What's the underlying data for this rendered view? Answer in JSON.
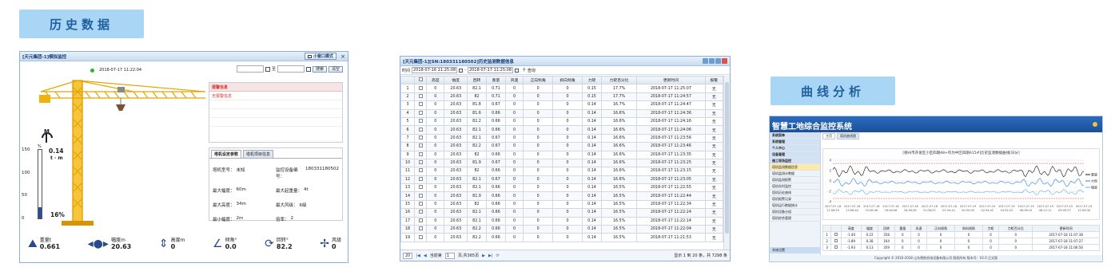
{
  "headings": {
    "history": "历史数据",
    "curve": "曲线分析"
  },
  "monitor": {
    "title": "[天元集团-1]模拟监控",
    "timestamp": "2018-07-17 11:22:04",
    "small_window_label": "小窗口模式",
    "date_sep": "至",
    "search_label": "搜索",
    "clear_label": "清空",
    "alarm_header": "报警信息",
    "no_alarm_text": "无报警信息",
    "tabs": [
      "塔机设定参数",
      "塔机项目信息"
    ],
    "params": [
      {
        "k": "塔机型号：",
        "v": "未知"
      },
      {
        "k": "监控设备编号：",
        "v": "180331180502"
      },
      {
        "k": "最大幅度：",
        "v": "60m"
      },
      {
        "k": "最大起重量：",
        "v": "4t"
      },
      {
        "k": "最大高度：",
        "v": "34m"
      },
      {
        "k": "最大风级：",
        "v": "6级"
      },
      {
        "k": "最小幅度：",
        "v": "2m"
      },
      {
        "k": "倍率：",
        "v": "2"
      }
    ],
    "moment": {
      "label": "M",
      "value": "0.14",
      "unit": "t · m",
      "percent_unit": "%",
      "percent": "16%",
      "percent_fraction": 0.16
    },
    "gauge_ticks": [
      "150",
      "100",
      "50",
      "0"
    ],
    "metrics": [
      {
        "label": "重量t",
        "value": "0.661",
        "icon": "weight-icon"
      },
      {
        "label": "幅度m",
        "value": "20.63",
        "icon": "amplitude-icon"
      },
      {
        "label": "高度m",
        "value": "0",
        "icon": "height-icon"
      },
      {
        "label": "倾角°",
        "value": "0.0",
        "icon": "tilt-icon"
      },
      {
        "label": "回转°",
        "value": "82.2",
        "icon": "rotation-icon"
      },
      {
        "label": "风级",
        "value": "0",
        "icon": "wind-icon"
      }
    ]
  },
  "history": {
    "title": "[天元集团-1][SN:180331180502]历史监测数据信息",
    "time_label": "时间",
    "start_date": "2018-07-16 11:25:08",
    "end_date": "2018-07-17 11:25:08",
    "query_label": "查询",
    "columns": [
      "",
      "",
      "高度",
      "幅度",
      "回转",
      "重量",
      "风速",
      "正向倾角",
      "斜向倾角",
      "力矩",
      "力矩百分比",
      "更新时间",
      "报警"
    ],
    "rows": [
      [
        "1",
        "0",
        "20.63",
        "82.1",
        "0.71",
        "0",
        "0",
        "0",
        "0.15",
        "17.7%",
        "2018-07-17 11:25:07",
        "无"
      ],
      [
        "2",
        "0",
        "20.63",
        "82",
        "0.71",
        "0",
        "0",
        "0",
        "0.15",
        "17.7%",
        "2018-07-17 11:24:57",
        "无"
      ],
      [
        "3",
        "0",
        "20.63",
        "81.8",
        "0.67",
        "0",
        "0",
        "0",
        "0.14",
        "16.7%",
        "2018-07-17 11:24:47",
        "无"
      ],
      [
        "4",
        "0",
        "20.63",
        "81.6",
        "0.66",
        "0",
        "0",
        "0",
        "0.14",
        "16.6%",
        "2018-07-17 11:24:36",
        "无"
      ],
      [
        "5",
        "0",
        "20.63",
        "82.2",
        "0.66",
        "0",
        "0",
        "0",
        "0.14",
        "16.6%",
        "2018-07-17 11:24:16",
        "无"
      ],
      [
        "6",
        "0",
        "20.63",
        "82.1",
        "0.66",
        "0",
        "0",
        "0",
        "0.14",
        "16.6%",
        "2018-07-17 11:24:06",
        "无"
      ],
      [
        "7",
        "0",
        "20.63",
        "82.1",
        "0.67",
        "0",
        "0",
        "0",
        "0.14",
        "16.6%",
        "2018-07-17 11:23:56",
        "无"
      ],
      [
        "8",
        "0",
        "20.63",
        "82.2",
        "0.67",
        "0",
        "0",
        "0",
        "0.14",
        "16.6%",
        "2018-07-17 11:23:46",
        "无"
      ],
      [
        "9",
        "0",
        "20.63",
        "82",
        "0.66",
        "0",
        "0",
        "0",
        "0.14",
        "16.6%",
        "2018-07-17 11:23:35",
        "无"
      ],
      [
        "10",
        "0",
        "20.63",
        "81.9",
        "0.67",
        "0",
        "0",
        "0",
        "0.14",
        "16.6%",
        "2018-07-17 11:23:25",
        "无"
      ],
      [
        "11",
        "0",
        "20.63",
        "82",
        "0.66",
        "0",
        "0",
        "0",
        "0.14",
        "16.6%",
        "2018-07-17 11:23:15",
        "无"
      ],
      [
        "12",
        "0",
        "20.63",
        "82.1",
        "0.67",
        "0",
        "0",
        "0",
        "0.14",
        "16.6%",
        "2018-07-17 11:23:05",
        "无"
      ],
      [
        "13",
        "0",
        "20.63",
        "82.1",
        "0.66",
        "0",
        "0",
        "0",
        "0.14",
        "16.5%",
        "2018-07-17 11:22:55",
        "无"
      ],
      [
        "14",
        "0",
        "20.63",
        "81.9",
        "0.66",
        "0",
        "0",
        "0",
        "0.14",
        "16.5%",
        "2018-07-17 11:22:44",
        "无"
      ],
      [
        "15",
        "0",
        "20.63",
        "82",
        "0.66",
        "0",
        "0",
        "0",
        "0.14",
        "16.5%",
        "2018-07-17 11:22:34",
        "无"
      ],
      [
        "16",
        "0",
        "20.63",
        "82.1",
        "0.66",
        "0",
        "0",
        "0",
        "0.14",
        "16.5%",
        "2018-07-17 11:22:24",
        "无"
      ],
      [
        "17",
        "0",
        "20.63",
        "82.1",
        "0.66",
        "0",
        "0",
        "0",
        "0.14",
        "16.5%",
        "2018-07-17 11:22:14",
        "无"
      ],
      [
        "18",
        "0",
        "20.63",
        "82.2",
        "0.66",
        "0",
        "0",
        "0",
        "0.14",
        "16.5%",
        "2018-07-17 11:22:04",
        "无"
      ],
      [
        "19",
        "0",
        "20.63",
        "82.2",
        "0.66",
        "0",
        "0",
        "0",
        "0.14",
        "16.5%",
        "2018-07-17 11:21:53",
        "无"
      ]
    ],
    "page_size": "20",
    "page_prefix": "当前第",
    "page_current": "1",
    "page_suffix": "页,共365页",
    "summary": "显示 1 到 20 条，共 7298 条"
  },
  "curve_app": {
    "brand": "智慧工地综合监控系统",
    "chart_title": "[德州市开发区小区四期A8+作为中区四期A15#]历史监测数据曲线[日分]",
    "footer": "Copyright © 2016-2018 山东德航机电设备有限公司 版权所有   版本号：V2.0   正式版",
    "menu": [
      "系统菜单",
      "系统管理",
      "个人中心",
      "设备管理",
      "施工现场监控",
      "塔机监测数据信息",
      "塔机监测计数据",
      "塔机监测报警",
      "塔机实时监控",
      "塔机历史曲线",
      "塔机报警记录",
      "塔机运行数据统计",
      "塔机设备分组",
      "塔机综合管理"
    ],
    "menu_bottom": "系统设置",
    "tabs": [
      "主页",
      "塔机曲线图"
    ],
    "legend": [
      "重量",
      "力矩",
      "幅度"
    ],
    "time_ticks": [
      "2017-07-18 11:06:29",
      "2017-07-18 13:06:44",
      "2017-07-18 15:06:46",
      "2017-07-18 16:46:58",
      "2017-07-18 18:36:28",
      "2017-07-18 21:06:53",
      "2017-07-18 22:34:14",
      "2017-07-19 00:35:05",
      "2017-07-19 02:34:42",
      "2017-07-19 04:35:23",
      "2017-07-19 06:36:15",
      "2017-07-19 08:12:11",
      "2017-07-19 09:09:37",
      "2017-07-19 11:05:06"
    ],
    "y_ticks": [
      "4",
      "2",
      "0",
      "-2",
      "-4"
    ],
    "mini_columns": [
      "",
      "",
      "高度",
      "幅度",
      "回转",
      "重量",
      "风速",
      "正向倾角",
      "斜向倾角",
      "力矩",
      "力矩百分比",
      "更新时间"
    ],
    "mini_rows": [
      [
        "1",
        "-1.40",
        "0.22",
        "358",
        "0",
        "0",
        "0",
        "0",
        "0",
        "0",
        "2017-07-18 11:07:38"
      ],
      [
        "2",
        "-1.89",
        "0.38",
        "164",
        "0",
        "0",
        "0",
        "0",
        "0",
        "0",
        "2017-07-18 11:07:27"
      ],
      [
        "3",
        "-1.93",
        "0.13",
        "359",
        "0",
        "0",
        "0",
        "0",
        "0",
        "0",
        "2017-07-18 11:06:56"
      ]
    ]
  },
  "colors": {
    "accent": "#1f5fa0",
    "badge_bg": "#a9d6f5",
    "crane": "#f2b20d",
    "alarm_red": "#d9302c",
    "status_green": "#2bb52b"
  }
}
